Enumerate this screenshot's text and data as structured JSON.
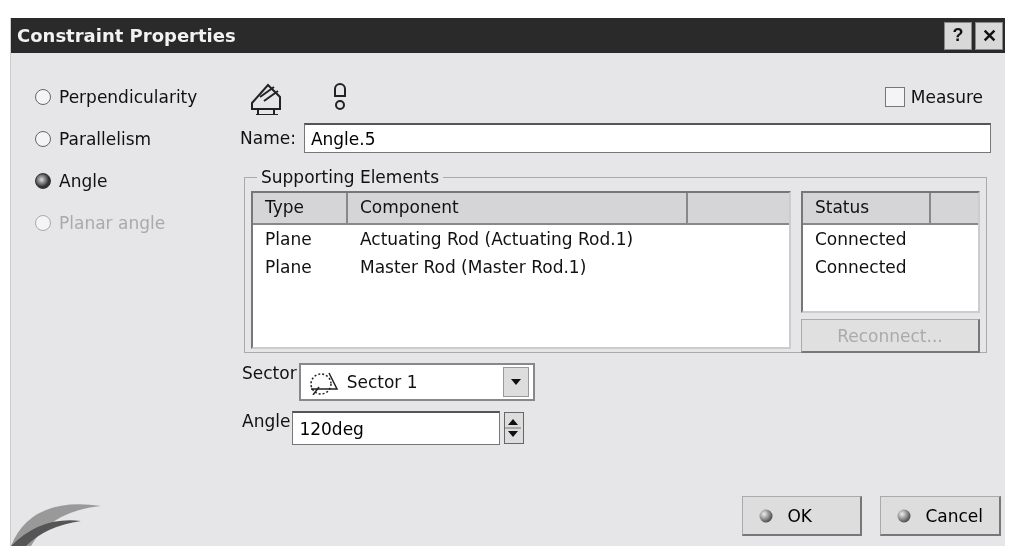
{
  "window": {
    "title": "Constraint Properties",
    "buttons": [
      "?",
      "✕"
    ]
  },
  "constraint_types": [
    {
      "label": "Perpendicularity",
      "selected": false,
      "disabled": false
    },
    {
      "label": "Parallelism",
      "selected": false,
      "disabled": false
    },
    {
      "label": "Angle",
      "selected": true,
      "disabled": false
    },
    {
      "label": "Planar angle",
      "selected": false,
      "disabled": true
    }
  ],
  "measure": {
    "label": "Measure",
    "checked": false
  },
  "name": {
    "label": "Name:",
    "value": "Angle.5"
  },
  "supporting_elements": {
    "title": "Supporting Elements",
    "table": {
      "columns": [
        "Type",
        "Component",
        ""
      ],
      "rows": [
        {
          "cells": [
            "Plane",
            "Actuating Rod (Actuating Rod.1)"
          ]
        },
        {
          "cells": [
            "Plane",
            "Master Rod (Master Rod.1)"
          ]
        }
      ]
    },
    "status_table": {
      "columns": [
        "Status",
        ""
      ],
      "rows": [
        "Connected",
        "Connected"
      ]
    },
    "reconnect": {
      "label": "Reconnect...",
      "disabled": true
    }
  },
  "sector": {
    "label": "Sector",
    "value": "Sector 1"
  },
  "angle": {
    "label": "Angle",
    "value": "120deg"
  },
  "buttons": [
    {
      "label": "OK"
    },
    {
      "label": "Cancel"
    }
  ]
}
